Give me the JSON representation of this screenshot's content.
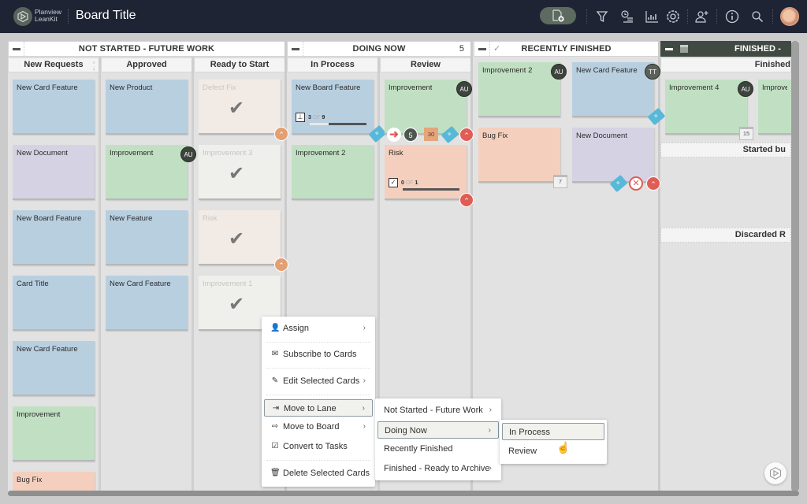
{
  "app": {
    "logo_line1": "Planview",
    "logo_line2": "LeanKit",
    "board_title": "Board Title"
  },
  "toolbar": {
    "icons": [
      "add-card-icon",
      "filter-icon",
      "timeline-icon",
      "analytics-icon",
      "settings-icon",
      "add-user-icon",
      "info-icon",
      "search-icon",
      "user-avatar"
    ]
  },
  "lane_groups": [
    {
      "title": "NOT STARTED - FUTURE WORK"
    },
    {
      "title": "DOING NOW",
      "count": "5"
    },
    {
      "title": "RECENTLY FINISHED"
    },
    {
      "title": "FINISHED -"
    }
  ],
  "lanes": [
    {
      "title": "New Requests"
    },
    {
      "title": "Approved"
    },
    {
      "title": "Ready to Start"
    },
    {
      "title": "In Process"
    },
    {
      "title": "Review"
    },
    {
      "title": "Finished"
    },
    {
      "title": "Started bu"
    },
    {
      "title": "Discarded R"
    }
  ],
  "cards": {
    "new_requests": [
      "New Card Feature",
      "New Document",
      "New Board Feature",
      "Card Title",
      "New Card Feature",
      "Improvement",
      "Bug Fix"
    ],
    "approved": [
      "New Product",
      "Improvement",
      "New Feature",
      "New Card Feature"
    ],
    "ready_to_start": [
      "Defect Fix",
      "Improvement 3",
      "Risk",
      "Improvement 1"
    ],
    "in_process": [
      "New Board Feature",
      "Improvement 2"
    ],
    "review": [
      "Improvement",
      "Risk"
    ],
    "recently_finished": [
      "Improvement 2",
      "New Card Feature",
      "Bug Fix",
      "New Document"
    ],
    "finished": [
      "Improvement 4",
      "Improven"
    ]
  },
  "card_meta": {
    "assignee_au": "AU",
    "assignee_tt": "TT",
    "in_process_progress": {
      "done": "3",
      "of": "OF",
      "total": "9",
      "fraction": 0.33
    },
    "review_risk_progress": {
      "done": "0",
      "of": "OF",
      "total": "1",
      "fraction": 0.0
    },
    "review_blocked_count": "5",
    "review_due_day": "30",
    "bug_fix_due_day": "7",
    "finished_due_day": "15"
  },
  "context_menu": {
    "items": [
      {
        "label": "Assign",
        "icon": "user-icon",
        "has_submenu": true
      },
      {
        "label": "Subscribe to Cards",
        "icon": "envelope-icon",
        "has_submenu": false
      },
      {
        "label": "Edit Selected Cards",
        "icon": "pencil-icon",
        "has_submenu": true
      },
      {
        "label": "Move to Lane",
        "icon": "move-in-icon",
        "has_submenu": true,
        "active": true
      },
      {
        "label": "Move to Board",
        "icon": "move-out-icon",
        "has_submenu": true
      },
      {
        "label": "Convert to Tasks",
        "icon": "checkbox-icon",
        "has_submenu": false
      },
      {
        "label": "Delete Selected Cards",
        "icon": "trash-icon",
        "has_submenu": false
      }
    ]
  },
  "lane_submenu": {
    "items": [
      {
        "label": "Not Started - Future Work",
        "has_submenu": true
      },
      {
        "label": "Doing Now",
        "has_submenu": true,
        "active": true
      },
      {
        "label": "Recently Finished",
        "has_submenu": false
      },
      {
        "label": "Finished - Ready to Archive",
        "has_submenu": true
      }
    ]
  },
  "doing_now_submenu": {
    "items": [
      {
        "label": "In Process",
        "active": true
      },
      {
        "label": "Review"
      }
    ]
  },
  "chevron": "›"
}
